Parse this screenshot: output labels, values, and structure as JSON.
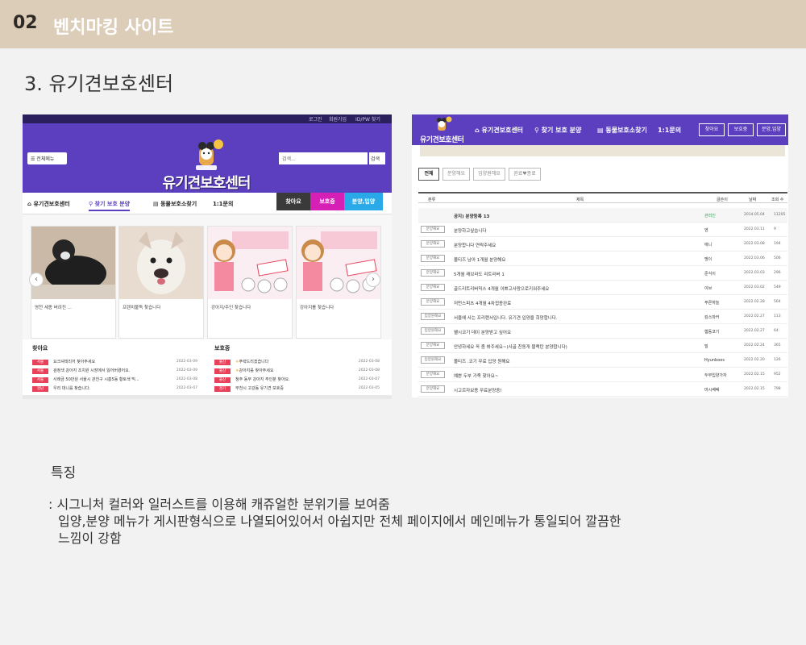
{
  "header": {
    "number": "02",
    "title": "벤치마킹 사이트"
  },
  "section_title": "3. 유기견보호센터",
  "left_site": {
    "util_links": [
      "로그인",
      "회원가입",
      "ID/PW 찾기"
    ],
    "menu_label": "☰ 전체메뉴",
    "search_placeholder": "검색...",
    "search_button": "검색",
    "logo_text": "유기견보호센터",
    "nav": [
      "유기견보호센터",
      "찾기 보호 분양",
      "동물보호소찾기",
      "1:1문의"
    ],
    "tabs": [
      "찾아요",
      "보호중",
      "분양,입양"
    ],
    "gallery_captions": [
      "영천 세종 버려진 ...",
      "프렌치불독 찾습니다",
      "강아지/주인 찾습니다",
      "강아지를 찾습니다"
    ],
    "board_find": {
      "title": "찾아요",
      "rows": [
        {
          "tag": "서울",
          "text": "요크셔테리어 찾아주세요",
          "date": "2022-03-09"
        },
        {
          "tag": "서울",
          "text": "검정색 강아지 조치원 시장에서 잃어버렸어요.",
          "date": "2022-03-09"
        },
        {
          "tag": "서울",
          "text": "사례금 50만원 서울시 관천구 시흥5동 황토색 믹...",
          "date": "2022-03-08"
        },
        {
          "tag": "경남",
          "text": "우리 대니를 찾습니다.",
          "date": "2022-03-07"
        }
      ]
    },
    "board_protect": {
      "title": "보호중",
      "rows": [
        {
          "tag": "울산",
          "text": "푸략드리겠습니다",
          "date": "2022-03-08"
        },
        {
          "tag": "울산",
          "text": "강아지를 찾아주세요",
          "date": "2022-03-08"
        },
        {
          "tag": "울산",
          "text": "청주 동부 강아지 주인분 찾아요.",
          "date": "2022-03-07"
        },
        {
          "tag": "경기",
          "text": "부천시 고강동 유기견 보호중",
          "date": "2022-03-05"
        }
      ]
    }
  },
  "right_site": {
    "logo_text": "유기견보호센터",
    "nav": [
      "유기견보호센터",
      "찾기 보호 분양",
      "동물보호소찾기",
      "1:1문의"
    ],
    "buttons": [
      "찾아요",
      "보호중",
      "분양,입양"
    ],
    "filters": [
      "전체",
      "분양해요",
      "입양원해요",
      "완료♥종료"
    ],
    "columns": [
      "분류",
      "제목",
      "글쓴이",
      "날짜",
      "조회 수"
    ],
    "notice": {
      "title": "공지) 분양등록 13",
      "author": "관리인",
      "date": "2014.05.04",
      "views": "11205"
    },
    "rows": [
      {
        "cat": "분양해요",
        "title": "분양하고싶습니다",
        "author": "엔",
        "date": "2022.03.11",
        "views": "9"
      },
      {
        "cat": "분양해요",
        "title": "분양합니다 연락주세요",
        "author": "애니",
        "date": "2022.03.08",
        "views": "194"
      },
      {
        "cat": "분양해요",
        "title": "몰티즈 남아 1개월 분양해요",
        "author": "맹이",
        "date": "2022.03.06",
        "views": "506"
      },
      {
        "cat": "분양해요",
        "title": "5개월 래브라도 리트리버 1",
        "author": "준식이",
        "date": "2022.03.03",
        "views": "296"
      },
      {
        "cat": "분양해요",
        "title": "골드리트리버믹스 4개월 이쁘고사랑으로키워주세요",
        "author": "이브",
        "date": "2022.03.02",
        "views": "549"
      },
      {
        "cat": "분양해요",
        "title": "저먼스피츠 4개월 4차접종완료",
        "author": "푸른하늘",
        "date": "2022.02.28",
        "views": "564"
      },
      {
        "cat": "입양원해요",
        "title": "서울에 사는 프리랜서입니다. 유기견 입양을 희망합니다.",
        "author": "킹스마커",
        "date": "2022.02.27",
        "views": "113"
      },
      {
        "cat": "입양원해요",
        "title": "웰시코기 데이 분양받고 싶어요",
        "author": "햄동코기",
        "date": "2022.02.27",
        "views": "64"
      },
      {
        "cat": "분양해요",
        "title": "안녕하세요 꼭 좀 봐주세요~(사골 친동개 블랙탄 분양합니다)",
        "author": "밀",
        "date": "2022.02.24",
        "views": "365"
      },
      {
        "cat": "입양원해요",
        "title": "몰티즈 .코기 무료 입양 원해요",
        "author": "Hyunboos",
        "date": "2022.02.20",
        "views": "126"
      },
      {
        "cat": "분양해요",
        "title": "예쁜 두부 가족 찾아요~",
        "author": "두부입양가자",
        "date": "2022.02.15",
        "views": "952"
      },
      {
        "cat": "분양해요",
        "title": "시고르자보종 무료분양중!",
        "author": "마시쎄쎄",
        "date": "2022.02.15",
        "views": "798"
      }
    ]
  },
  "features": {
    "title": "특징",
    "line1": ": 시그니처 컬러와 일러스트를 이용해 캐쥬얼한 분위기를 보여줌",
    "line2": "입양,분양 메뉴가 게시판형식으로 나열되어있어서 아쉽지만  전체 페이지에서 메인메뉴가 통일되어 깔끔한",
    "line3": "느낌이 강함"
  },
  "colors": {
    "brand_purple": "#5b3fbf",
    "header_beige": "#dccdb8",
    "tab_dark": "#3a3a3a",
    "tab_magenta": "#d61fb4",
    "tab_blue": "#2aa9e8",
    "tag_red": "#e8425a",
    "tag_orange": "#f0a020"
  }
}
